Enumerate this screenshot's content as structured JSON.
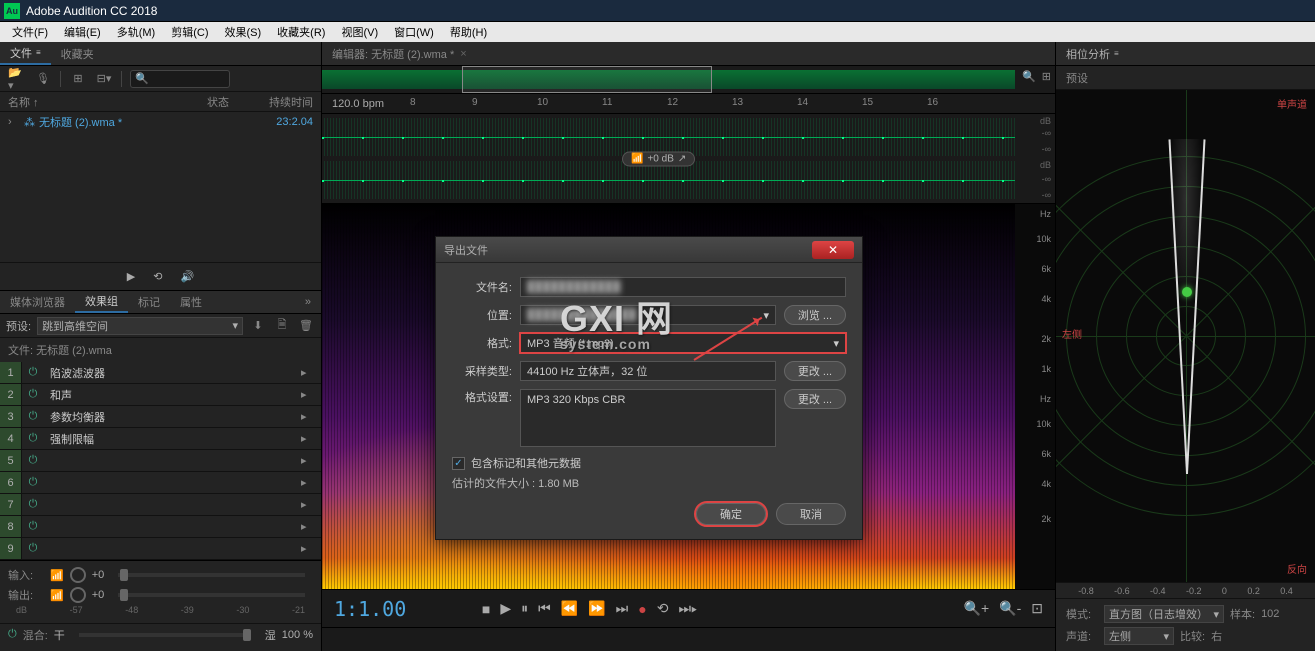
{
  "app": {
    "title": "Adobe Audition CC 2018",
    "icon_text": "Au"
  },
  "menubar": [
    "文件(F)",
    "编辑(E)",
    "多轨(M)",
    "剪辑(C)",
    "效果(S)",
    "收藏夹(R)",
    "视图(V)",
    "窗口(W)",
    "帮助(H)"
  ],
  "files_panel": {
    "tab_files": "文件",
    "tab_fav": "收藏夹",
    "col_name": "名称 ↑",
    "col_status": "状态",
    "col_dur": "持续时间",
    "rows": [
      {
        "name": "无标题 (2).wma *",
        "dur": "23:2.04"
      }
    ]
  },
  "browser_panel": {
    "tabs": [
      "媒体浏览器",
      "效果组",
      "标记",
      "属性"
    ],
    "preset_label": "预设:",
    "preset_value": "跳到高维空间",
    "file_label": "文件: 无标题 (2).wma",
    "fx": [
      {
        "n": "1",
        "name": "陷波滤波器"
      },
      {
        "n": "2",
        "name": "和声"
      },
      {
        "n": "3",
        "name": "参数均衡器"
      },
      {
        "n": "4",
        "name": "强制限幅"
      },
      {
        "n": "5",
        "name": ""
      },
      {
        "n": "6",
        "name": ""
      },
      {
        "n": "7",
        "name": ""
      },
      {
        "n": "8",
        "name": ""
      },
      {
        "n": "9",
        "name": ""
      }
    ],
    "io_in": "输入:",
    "io_out": "输出:",
    "io_val": "+0",
    "db_ticks": [
      "dB",
      "-57",
      "-48",
      "-39",
      "-30",
      "-21"
    ],
    "mix_label": "混合:",
    "mix_dry": "干",
    "mix_wet": "湿",
    "mix_val": "100 %"
  },
  "editor": {
    "header": "编辑器: 无标题 (2).wma *",
    "bpm": "120.0 bpm",
    "ticks": [
      "8",
      "9",
      "10",
      "11",
      "12",
      "13",
      "14",
      "15",
      "16"
    ],
    "gain_pill": "+0 dB",
    "db_labels": [
      "dB",
      "-∞",
      "-∞",
      "dB",
      "-∞",
      "-∞"
    ],
    "hz_labels_upper": [
      "Hz",
      "10k",
      "6k",
      "4k",
      "2k",
      "1k"
    ],
    "hz_labels_lower": [
      "Hz",
      "10k",
      "6k",
      "4k",
      "2k"
    ],
    "timecode": "1:1.00"
  },
  "phase_panel": {
    "title": "相位分析",
    "preset": "预设",
    "corners": {
      "tr": "单声道",
      "ml": "左侧",
      "br": "反向"
    },
    "axis": [
      "-0.8",
      "-0.6",
      "-0.4",
      "-0.2",
      "0",
      "0.2",
      "0.4"
    ],
    "mode_label": "模式:",
    "mode_value": "直方图（日志增效）",
    "sample_label": "样本:",
    "sample_value": "102",
    "chan_label": "声道:",
    "chan_value": "左侧",
    "compare_label": "比较:",
    "compare_value": "右"
  },
  "dialog": {
    "title": "导出文件",
    "filename_label": "文件名:",
    "location_label": "位置:",
    "format_label": "格式:",
    "format_value": "MP3 音频 (*.mp3)",
    "sample_label": "采样类型:",
    "sample_value": "44100 Hz 立体声，32 位",
    "fmtset_label": "格式设置:",
    "fmtset_value": "MP3 320 Kbps CBR",
    "browse": "浏览 ...",
    "change": "更改 ...",
    "include_label": "包含标记和其他元数据",
    "estimate": "估计的文件大小 : 1.80 MB",
    "ok": "确定",
    "cancel": "取消"
  },
  "watermark": {
    "main": "GXI 网",
    "sub": "system.com"
  }
}
